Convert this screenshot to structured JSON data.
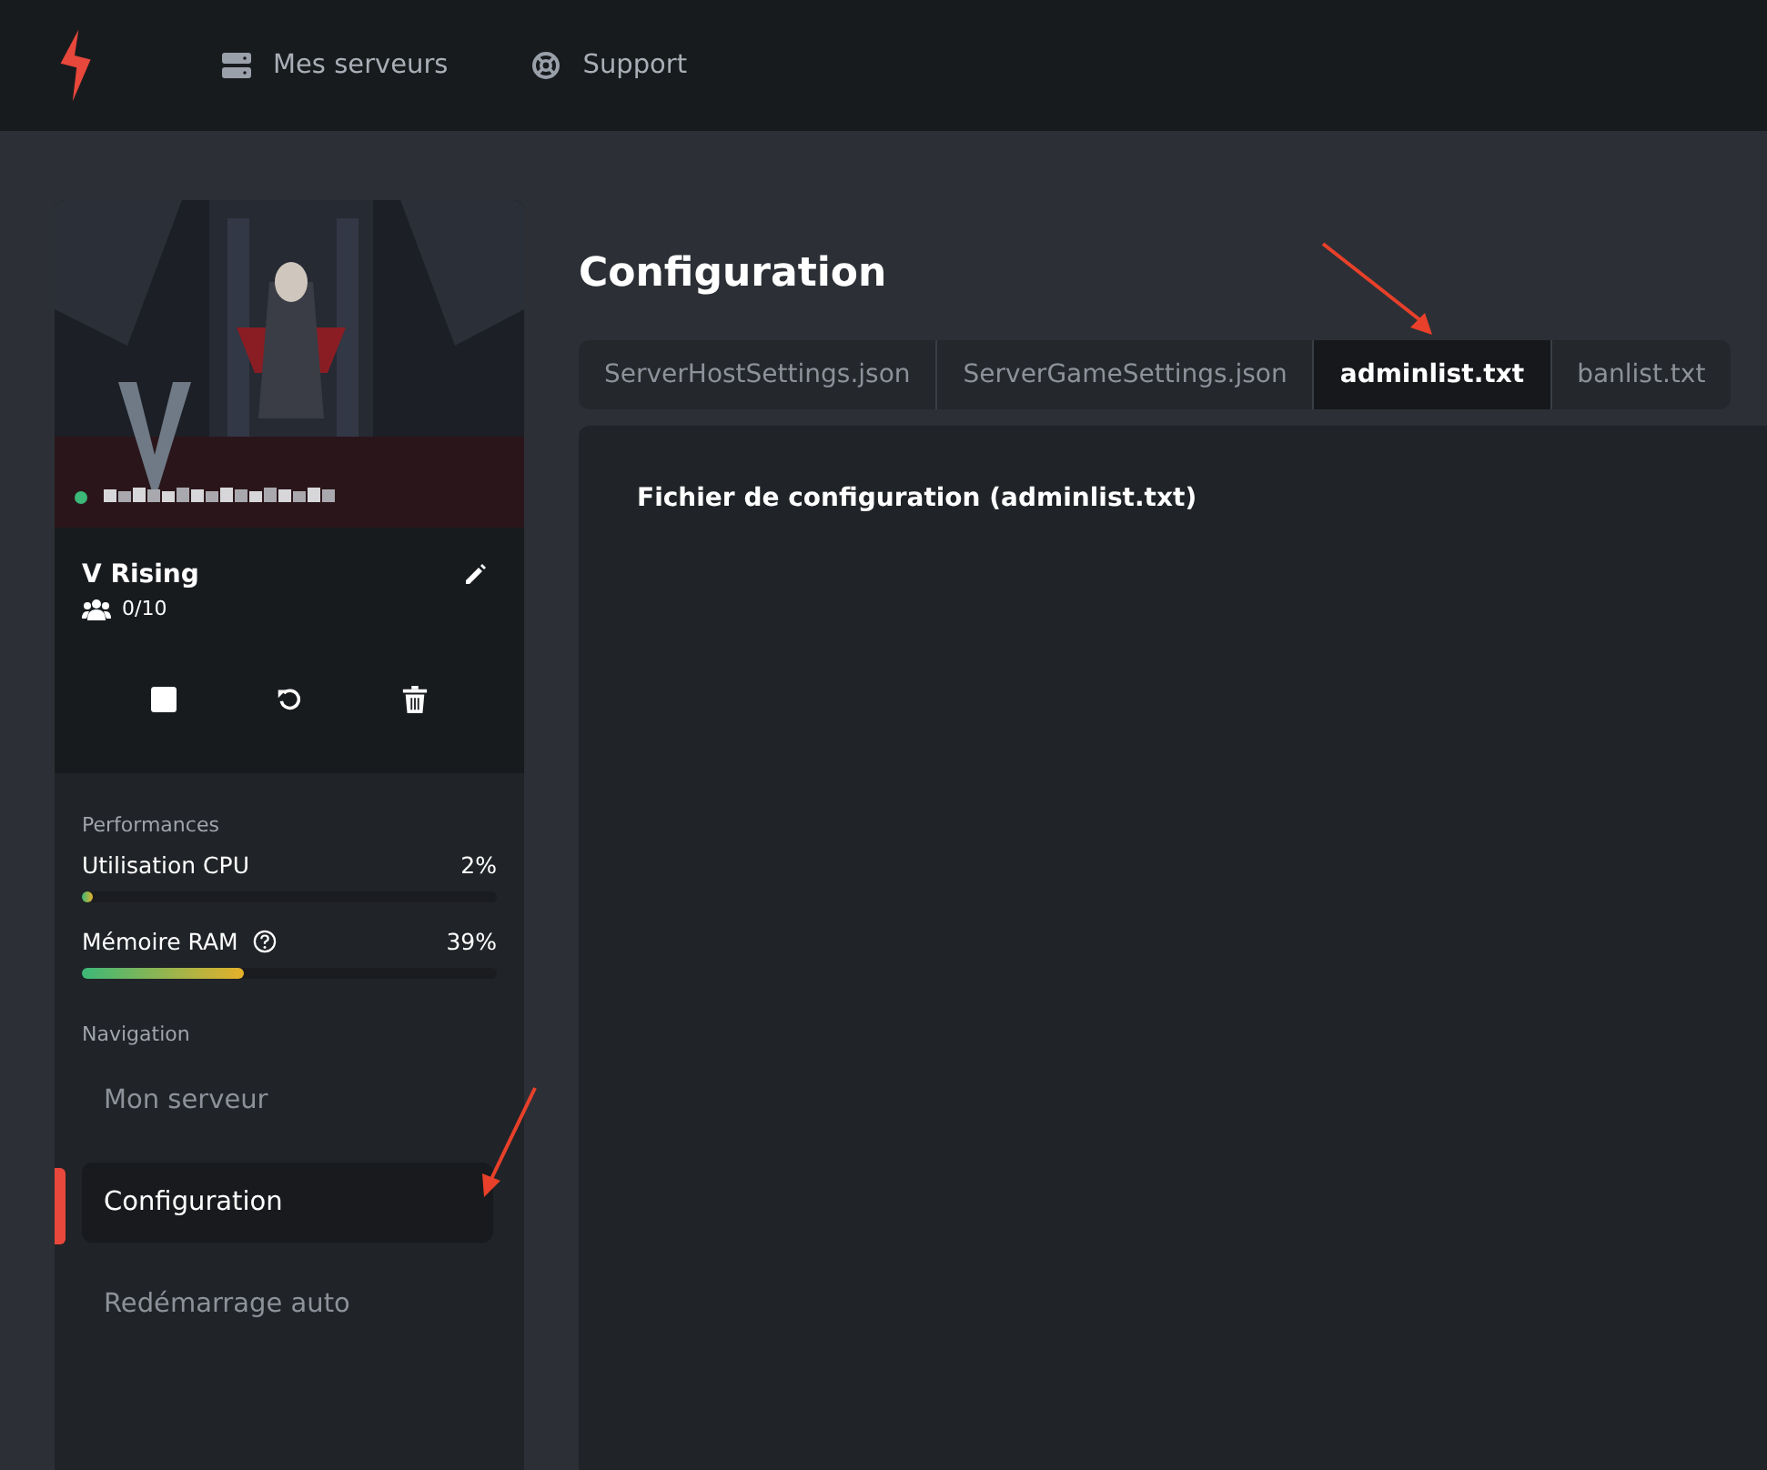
{
  "header": {
    "nav": [
      {
        "kind": "servers",
        "label": "Mes serveurs"
      },
      {
        "kind": "support",
        "label": "Support"
      }
    ]
  },
  "server": {
    "online": true,
    "name": "V Rising",
    "players": "0/10"
  },
  "performance": {
    "title": "Performances",
    "meters": [
      {
        "kind": "plain",
        "label": "Utilisation CPU",
        "reading": "2%",
        "level": 0.02
      },
      {
        "kind": "with_help",
        "label": "Mémoire RAM",
        "reading": "39%",
        "level": 0.39
      }
    ]
  },
  "navigation": {
    "title": "Navigation",
    "items": [
      {
        "label": "Mon serveur",
        "selected": false
      },
      {
        "label": "Configuration",
        "selected": true
      },
      {
        "label": "Redémarrage auto",
        "selected": false
      }
    ]
  },
  "page": {
    "title": "Configuration",
    "tabs": [
      {
        "label": "ServerHostSettings.json",
        "selected": false
      },
      {
        "label": "ServerGameSettings.json",
        "selected": false
      },
      {
        "label": "adminlist.txt",
        "selected": true
      },
      {
        "label": "banlist.txt",
        "selected": false
      }
    ],
    "panel_title": "Fichier de configuration (adminlist.txt)"
  }
}
